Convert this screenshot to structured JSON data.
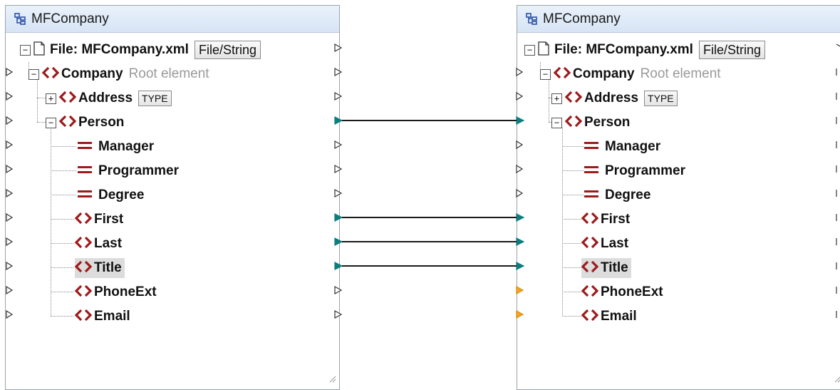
{
  "colors": {
    "element_icon": "#9e1a1a",
    "connected_connector": "#0d7d7d",
    "required_connector": "#f5a623",
    "header_bg": "#dde8f6"
  },
  "icons": {
    "component": "component-tree-icon",
    "file": "file-page-icon",
    "element": "angle-brackets-element-icon",
    "attribute": "equals-attribute-icon",
    "expand": "plus-box-icon",
    "collapse": "minus-box-icon"
  },
  "left": {
    "title": "MFCompany",
    "file_label": "File: MFCompany.xml",
    "file_button": "File/String",
    "root_label": "Company",
    "root_note": "Root element",
    "address_label": "Address",
    "type_badge": "TYPE",
    "person_label": "Person",
    "manager_label": "Manager",
    "programmer_label": "Programmer",
    "degree_label": "Degree",
    "first_label": "First",
    "last_label": "Last",
    "title_label": "Title",
    "phoneext_label": "PhoneExt",
    "email_label": "Email"
  },
  "right": {
    "title": "MFCompany",
    "file_label": "File: MFCompany.xml",
    "file_button": "File/String",
    "root_label": "Company",
    "root_note": "Root element",
    "address_label": "Address",
    "type_badge": "TYPE",
    "person_label": "Person",
    "manager_label": "Manager",
    "programmer_label": "Programmer",
    "degree_label": "Degree",
    "first_label": "First",
    "last_label": "Last",
    "title_label": "Title",
    "phoneext_label": "PhoneExt",
    "email_label": "Email"
  },
  "mappings": [
    {
      "from": "Person",
      "to": "Person"
    },
    {
      "from": "First",
      "to": "First"
    },
    {
      "from": "Last",
      "to": "Last"
    },
    {
      "from": "Title",
      "to": "Title"
    }
  ]
}
